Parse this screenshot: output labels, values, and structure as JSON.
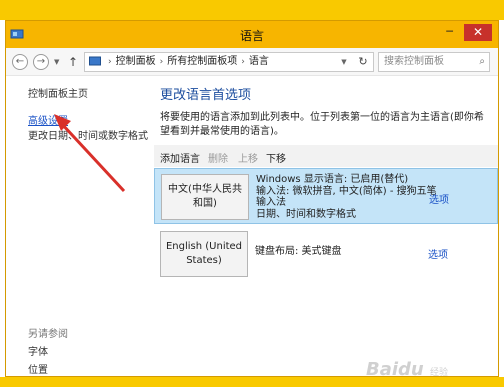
{
  "window": {
    "title": "语言",
    "caption": {
      "minimize": "─",
      "close": "✕"
    }
  },
  "address": {
    "back": "←",
    "forward": "→",
    "up": "↑",
    "crumbs": [
      "控制面板",
      "所有控制面板项",
      "语言"
    ],
    "refresh": "↻",
    "search_placeholder": "搜索控制面板"
  },
  "sidebar": {
    "home": "控制面板主页",
    "advanced": "高级设置",
    "date_format": "更改日期、时间或数字格式",
    "see_also": "另请参阅",
    "font": "字体",
    "location": "位置"
  },
  "main": {
    "heading": "更改语言首选项",
    "description": "将要使用的语言添加到此列表中。位于列表第一位的语言为主语言(即你希望看到并最常使用的语言)。",
    "toolbar": {
      "add": "添加语言",
      "remove": "删除",
      "up": "上移",
      "down": "下移"
    },
    "languages": [
      {
        "name": "中文(中华人民共和国)",
        "details": [
          "Windows 显示语言: 已启用(替代)",
          "输入法: 微软拼音, 中文(简体) - 搜狗五笔",
          "输入法",
          "日期、时间和数字格式"
        ],
        "options": "选项",
        "selected": true
      },
      {
        "name": "English (United States)",
        "details": [
          "键盘布局: 美式键盘"
        ],
        "options": "选项",
        "selected": false
      }
    ]
  },
  "watermark": {
    "text": "Baidu",
    "sub": "经验"
  },
  "colors": {
    "banner": "#f9c900",
    "titlebar": "#f7b500",
    "link": "#1a52c6",
    "heading": "#1b4c9e",
    "selected_row": "#c4e4f8",
    "close_button": "#c7312b",
    "arrow": "#d9302a"
  }
}
